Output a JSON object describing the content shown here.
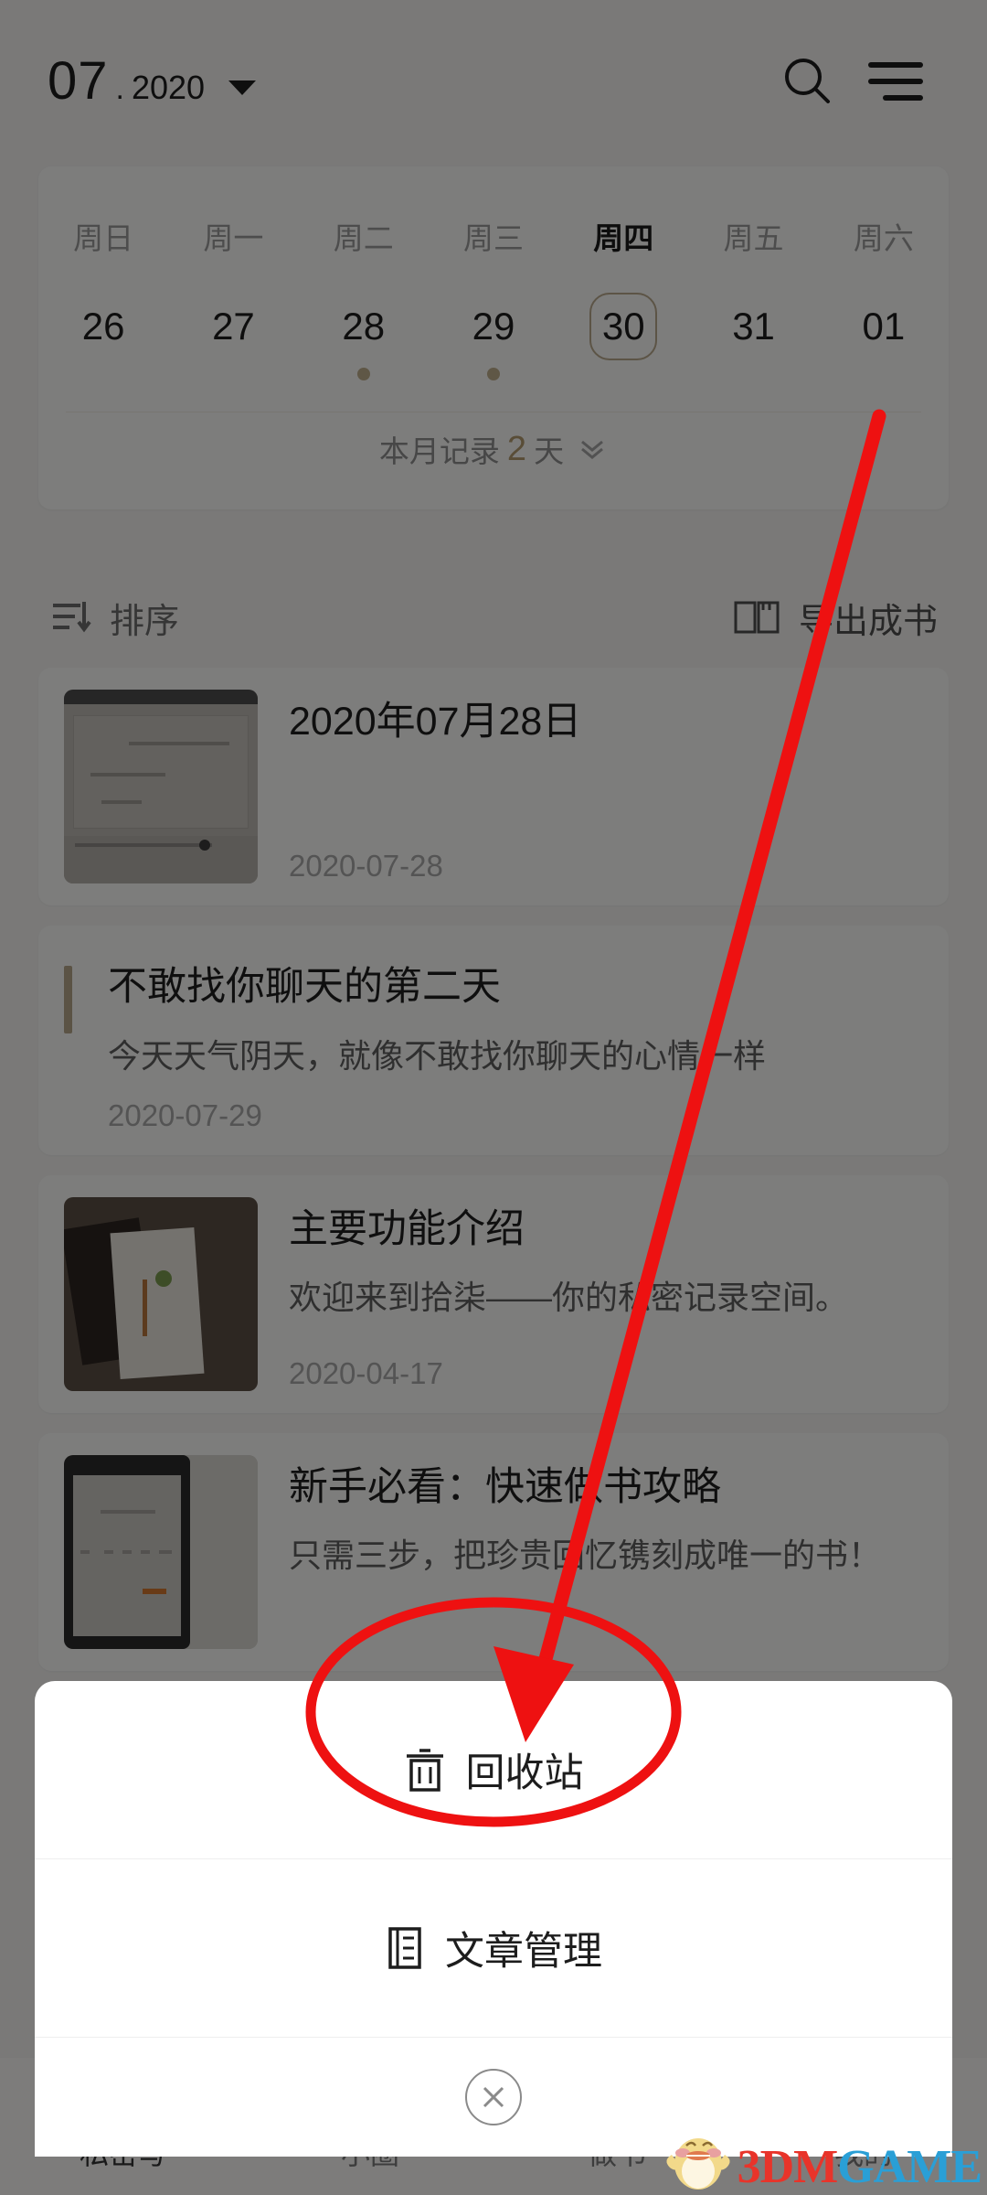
{
  "header": {
    "month": "07",
    "separator": ".",
    "year": "2020",
    "search_icon": "search-icon",
    "menu_icon": "hamburger-menu-icon"
  },
  "calendar": {
    "weekday_names": [
      "周日",
      "周一",
      "周二",
      "周三",
      "周四",
      "周五",
      "周六"
    ],
    "active_weekday_index": 4,
    "days": [
      "26",
      "27",
      "28",
      "29",
      "30",
      "31",
      "01"
    ],
    "selected_day_index": 4,
    "dot_indices": [
      2,
      3
    ],
    "summary_prefix": "本月记录",
    "summary_count": "2",
    "summary_suffix": "天",
    "summary_chevron": "chevron-double-down-icon",
    "accent_color": "#b29a6e"
  },
  "toolbar": {
    "sort_label": "排序",
    "sort_icon": "sort-descending-icon",
    "export_label": "导出成书",
    "export_icon": "open-book-icon"
  },
  "entries": [
    {
      "title": "2020年07月28日",
      "desc": "",
      "date": "2020-07-28",
      "has_thumb": true,
      "thumb_kind": "tn1",
      "accent_bar": false
    },
    {
      "title": "不敢找你聊天的第二天",
      "desc": "今天天气阴天，就像不敢找你聊天的心情一样",
      "date": "2020-07-29",
      "has_thumb": false,
      "thumb_kind": "",
      "accent_bar": true
    },
    {
      "title": "主要功能介绍",
      "desc": "欢迎来到拾柒——你的私密记录空间。",
      "date": "2020-04-17",
      "has_thumb": true,
      "thumb_kind": "tn2",
      "accent_bar": false
    },
    {
      "title": "新手必看：快速做书攻略",
      "desc": "只需三步，把珍贵回忆镌刻成唯一的书！",
      "date": "",
      "has_thumb": true,
      "thumb_kind": "tn3",
      "accent_bar": false
    }
  ],
  "tabbar": {
    "items": [
      {
        "label": "私密写"
      },
      {
        "label": "小圈"
      },
      {
        "label": "做书"
      },
      {
        "label": "我的"
      }
    ],
    "active_index": 0
  },
  "action_sheet": {
    "items": [
      {
        "label": "回收站",
        "icon": "trash-can-icon"
      },
      {
        "label": "文章管理",
        "icon": "document-list-icon"
      }
    ],
    "close_icon": "close-circle-icon"
  },
  "annotations": {
    "highlight_color": "#ee1111",
    "arrow_label": "red-arrow-pointing-to-recycle-bin",
    "ellipse_label": "red-ellipse-around-recycle-bin"
  },
  "watermark": {
    "part1": "3DM",
    "part2": "GAME",
    "mascot": "yellow-duck-mascot-icon"
  }
}
